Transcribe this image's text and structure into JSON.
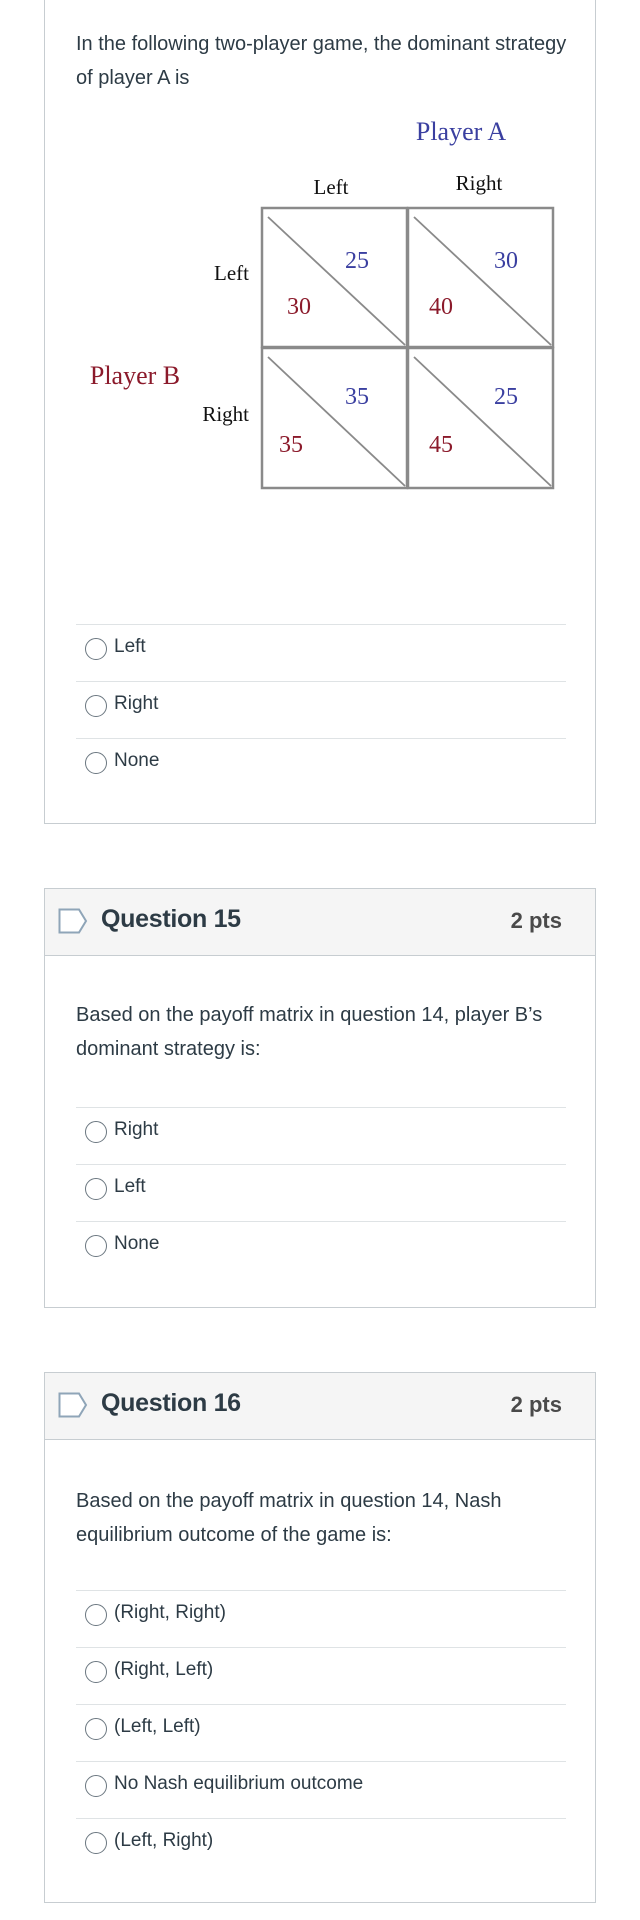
{
  "questions": [
    {
      "id": "q14",
      "text": "In the following two-player game, the dominant strategy of player A is",
      "payoff_matrix": {
        "column_player": "Player A",
        "row_player": "Player B",
        "column_strategies": [
          "Left",
          "Right"
        ],
        "row_strategies": [
          "Left",
          "Right"
        ],
        "cells": [
          {
            "row": "Left",
            "col": "Left",
            "player_a": "25",
            "player_b": "30"
          },
          {
            "row": "Left",
            "col": "Right",
            "player_a": "30",
            "player_b": "40"
          },
          {
            "row": "Right",
            "col": "Left",
            "player_a": "35",
            "player_b": "35"
          },
          {
            "row": "Right",
            "col": "Right",
            "player_a": "25",
            "player_b": "45"
          }
        ],
        "colors": {
          "player_a": "#3a3fa0",
          "player_b": "#8b1a2b",
          "labels": "#111111"
        }
      },
      "answers": [
        "Left",
        "Right",
        "None"
      ]
    },
    {
      "id": "q15",
      "title": "Question 15",
      "points": "2 pts",
      "text": "Based on the payoff matrix in question 14, player B’s dominant strategy is:",
      "answers": [
        "Right",
        "Left",
        "None"
      ]
    },
    {
      "id": "q16",
      "title": "Question 16",
      "points": "2 pts",
      "text": "Based on the payoff matrix in question 14, Nash equilibrium outcome of the game is:",
      "answers": [
        "(Right, Right)",
        "(Right, Left)",
        "(Left, Left)",
        "No Nash equilibrium outcome",
        "(Left, Right)"
      ]
    }
  ],
  "icons": {
    "flag": "flag-question-icon",
    "radio": "radio-unchecked"
  }
}
